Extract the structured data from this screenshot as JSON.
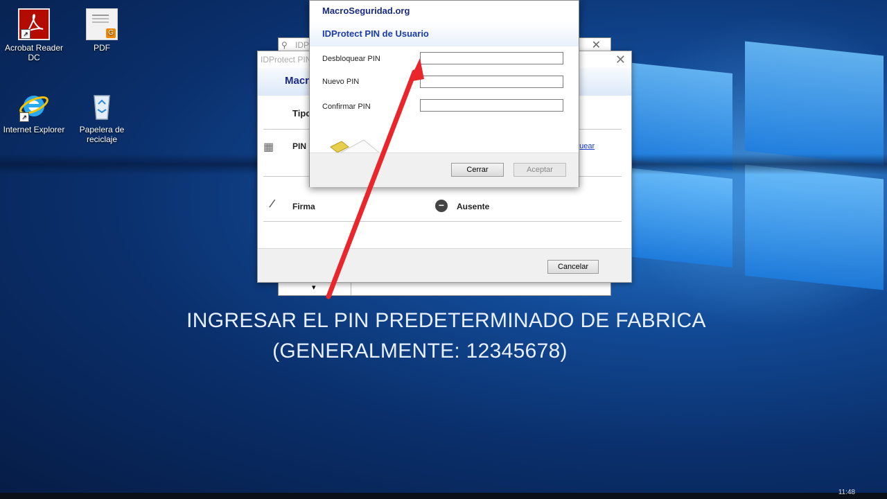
{
  "desktop": {
    "icons": [
      {
        "label": "Acrobat Reader DC"
      },
      {
        "label": "PDF"
      },
      {
        "label": "Internet Explorer"
      },
      {
        "label": "Papelera de reciclaje"
      }
    ]
  },
  "background_window": {
    "title": "IDP",
    "dropdown_arrow": "▾"
  },
  "main_window": {
    "title": "IDProtect PIN",
    "header": "Macr",
    "column_label": "Tipo",
    "rows": [
      {
        "name": "PIN",
        "action_link": "quear"
      },
      {
        "name": "Firma",
        "status": "Ausente"
      }
    ],
    "cancel_label": "Cancelar"
  },
  "pin_dialog": {
    "brand": "MacroSeguridad.org",
    "title": "IDProtect PIN de Usuario",
    "fields": [
      {
        "label": "Desbloquear PIN",
        "value": ""
      },
      {
        "label": "Nuevo PIN",
        "value": ""
      },
      {
        "label": "Confirmar PIN",
        "value": ""
      }
    ],
    "close_label": "Cerrar",
    "accept_label": "Aceptar"
  },
  "caption": {
    "line1": "INGRESAR EL PIN PREDETERMINADO DE FABRICA",
    "line2": "(GENERALMENTE: 12345678)"
  },
  "taskbar": {
    "clock": "11:48"
  },
  "colors": {
    "arrow": "#e8262b",
    "brand_text": "#1a2a80"
  }
}
